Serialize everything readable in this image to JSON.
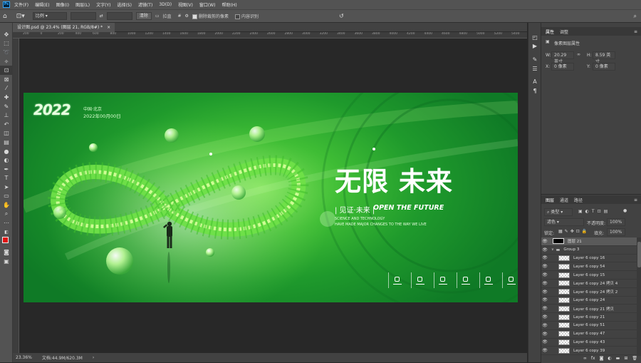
{
  "menu": [
    "文件(F)",
    "编辑(E)",
    "图像(I)",
    "图层(L)",
    "文字(Y)",
    "选择(S)",
    "滤镜(T)",
    "3D(D)",
    "视图(V)",
    "窗口(W)",
    "帮助(H)"
  ],
  "options": {
    "ratio": "比例",
    "clear": "清除",
    "straighten": "拉直",
    "delete_cropped": "删除裁剪的像素",
    "content_aware": "内容识别"
  },
  "doc_tab": "设计图.psd @ 23.4% (图层 21, RGB/8#) *",
  "ruler_h": [
    "200",
    "0",
    "200",
    "400",
    "600",
    "800",
    "1000",
    "1200",
    "1400",
    "1600",
    "1800",
    "2000",
    "2200",
    "2400",
    "2600",
    "2800",
    "3000",
    "3200",
    "3400",
    "3600",
    "3800",
    "4000",
    "4200",
    "4400",
    "4600",
    "4800",
    "5000",
    "5200",
    "5400",
    "5600"
  ],
  "status": {
    "zoom": "23.36%",
    "doc": "文档:44.9M/620.3M"
  },
  "poster": {
    "year": "2022",
    "location": "中国·北京",
    "date": "2022年00月00日",
    "title": "无限 未来",
    "sub_cn": "| 见证·未来 |",
    "sub_en": "OPEN THE FUTURE",
    "line1": "SCIENCE AND TECHNOLOGY",
    "line2": "HAVE MADE MAJOR CHANGES TO THE WAY WE LIVE"
  },
  "properties": {
    "tab1": "属性",
    "tab2": "调整",
    "section": "像素图层属性",
    "w_label": "W:",
    "w_val": "20.29 英寸",
    "h_label": "H:",
    "h_val": "8.59 英寸",
    "x_label": "X:",
    "x_val": "0 像素",
    "y_label": "Y:",
    "y_val": "0 像素"
  },
  "layers_panel": {
    "tabs": [
      "图层",
      "通道",
      "路径"
    ],
    "kind": "类型",
    "blend": "滤色",
    "opacity_label": "不透明度:",
    "opacity": "100%",
    "lock_label": "锁定:",
    "fill_label": "填充:",
    "fill": "100%",
    "rows": [
      "图层 21",
      "Group 3",
      "Layer 6 copy 16",
      "Layer 6 copy 54",
      "Layer 6 copy 15",
      "Layer 6 copy 24 拷贝 4",
      "Layer 6 copy 24 拷贝 2",
      "Layer 6 copy 24",
      "Layer 6 copy 21 拷贝",
      "Layer 6 copy 21",
      "Layer 6 copy 51",
      "Layer 6 copy 47",
      "Layer 6 copy 43",
      "Layer 6 copy 39"
    ]
  }
}
